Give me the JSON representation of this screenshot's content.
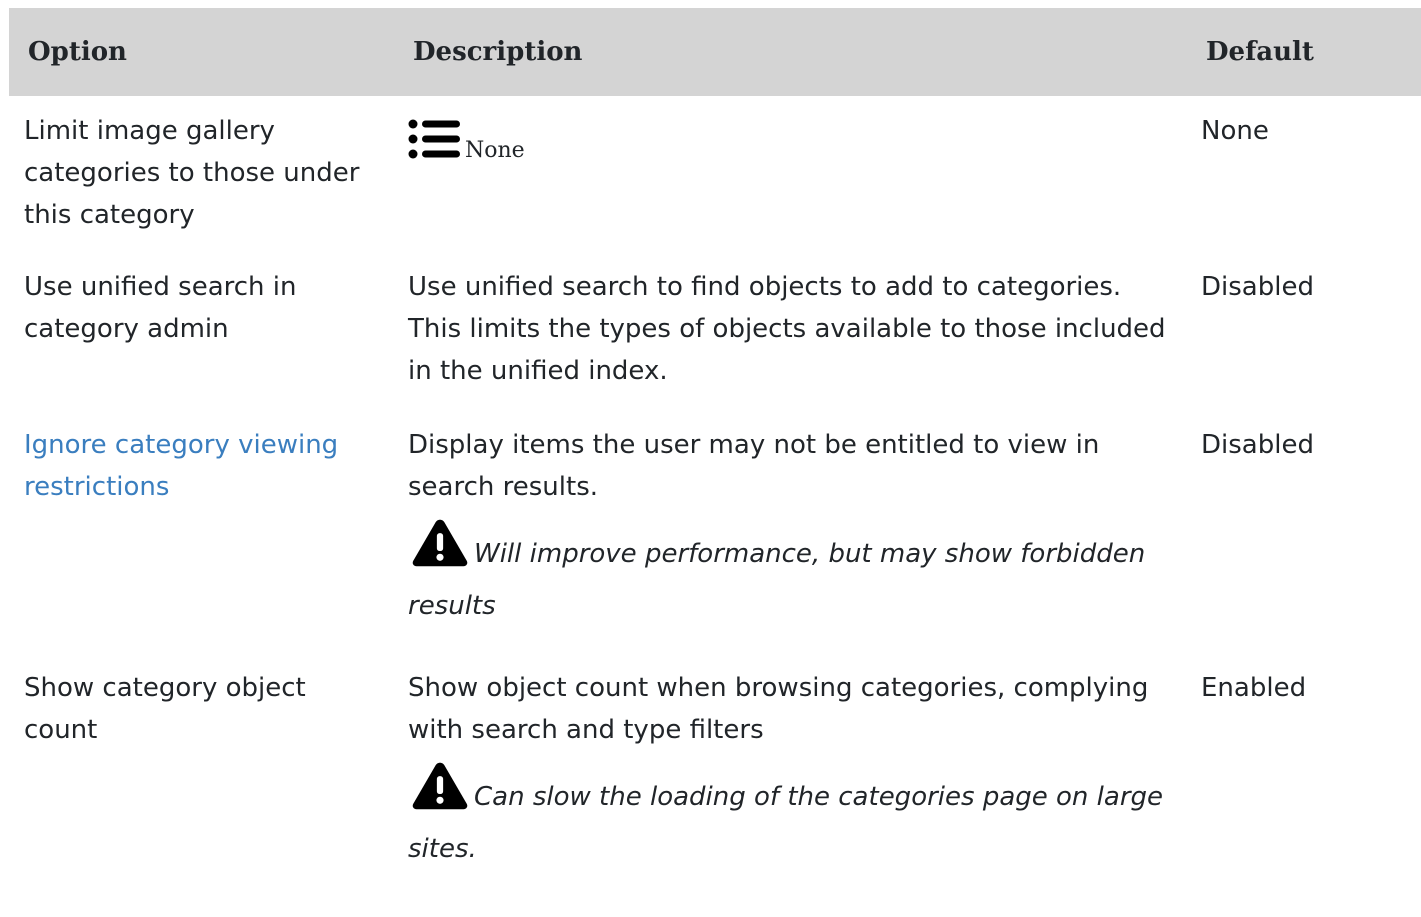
{
  "table": {
    "headers": {
      "option": "Option",
      "description": "Description",
      "default": "Default"
    },
    "rows": [
      {
        "option": "Limit image gallery categories to those under this category",
        "description_icon": "list-icon",
        "description": "None",
        "default": "None"
      },
      {
        "option": "Use unified search in category admin",
        "description": "Use unified search to find objects to add to categories. This limits the types of objects available to those included in the unified index.",
        "default": "Disabled"
      },
      {
        "option": "Ignore category viewing restrictions",
        "option_is_link": true,
        "description": "Display items the user may not be entitled to view in search results.",
        "warning_icon": "warning-icon",
        "warning": "Will improve performance, but may show forbidden results",
        "default": "Disabled"
      },
      {
        "option": "Show category object count",
        "description": "Show object count when browsing categories, complying with search and type filters",
        "warning_icon": "warning-icon",
        "warning": "Can slow the loading of the categories page on large sites.",
        "default": "Enabled"
      }
    ]
  },
  "colors": {
    "header_bg": "#d4d4d4",
    "link": "#3a7ebf",
    "text": "#212529"
  }
}
